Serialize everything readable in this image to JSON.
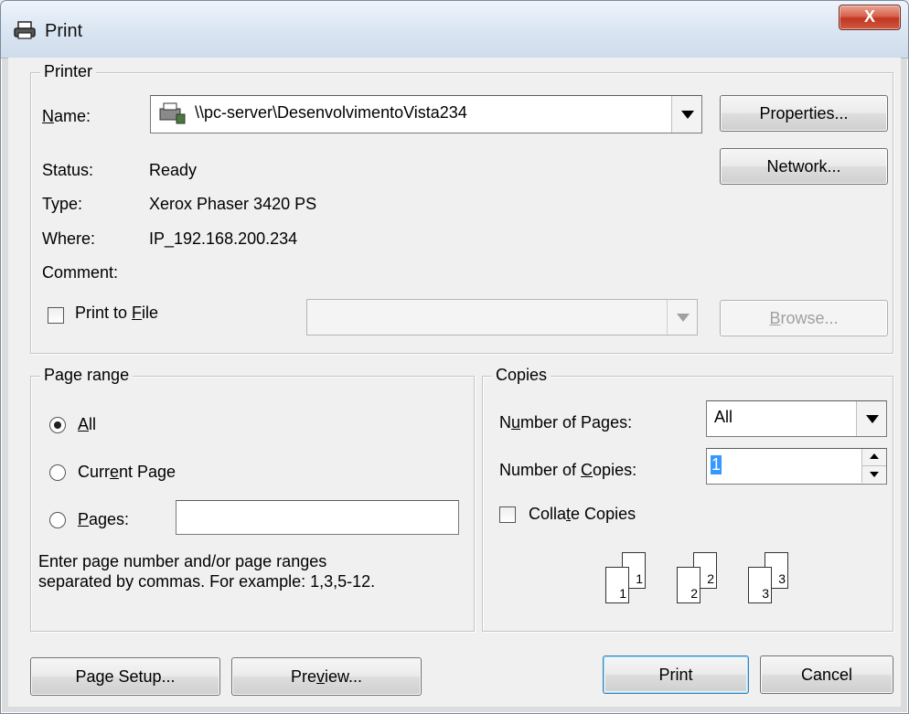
{
  "window": {
    "title": "Print",
    "close_label": "X"
  },
  "printer_group": {
    "legend": "Printer",
    "name_label": "Name:",
    "printer_name": "\\\\pc-server\\DesenvolvimentoVista234",
    "properties_button": "Properties...",
    "network_button": "Network...",
    "status_label": "Status:",
    "status_value": "Ready",
    "type_label": "Type:",
    "type_value": "Xerox Phaser 3420 PS",
    "where_label": "Where:",
    "where_value": "IP_192.168.200.234",
    "comment_label": "Comment:",
    "comment_value": "",
    "print_to_file_label": "Print to File",
    "print_to_file_checked": false,
    "file_combo_value": "",
    "browse_button": "Browse..."
  },
  "page_range": {
    "legend": "Page range",
    "options": [
      {
        "label": "All",
        "selected": true
      },
      {
        "label": "Current Page",
        "selected": false
      },
      {
        "label": "Pages:",
        "selected": false
      }
    ],
    "pages_value": "",
    "hint_line1": "Enter page number and/or page ranges",
    "hint_line2": "separated by commas. For example: 1,3,5-12."
  },
  "copies": {
    "legend": "Copies",
    "number_of_pages_label": "Number of Pages:",
    "number_of_pages_value": "All",
    "number_of_copies_label": "Number of Copies:",
    "number_of_copies_value": "1",
    "collate_label": "Collate Copies",
    "collate_checked": false,
    "collate_pages": [
      "1",
      "1",
      "2",
      "2",
      "3",
      "3"
    ]
  },
  "footer": {
    "page_setup_button": "Page Setup...",
    "preview_button": "Preview...",
    "print_button": "Print",
    "cancel_button": "Cancel"
  },
  "colors": {
    "titlebar": "#dbe6f3",
    "dialog_bg": "#f0f0f0",
    "close_button": "#c2361f",
    "selection": "#3399ff"
  }
}
